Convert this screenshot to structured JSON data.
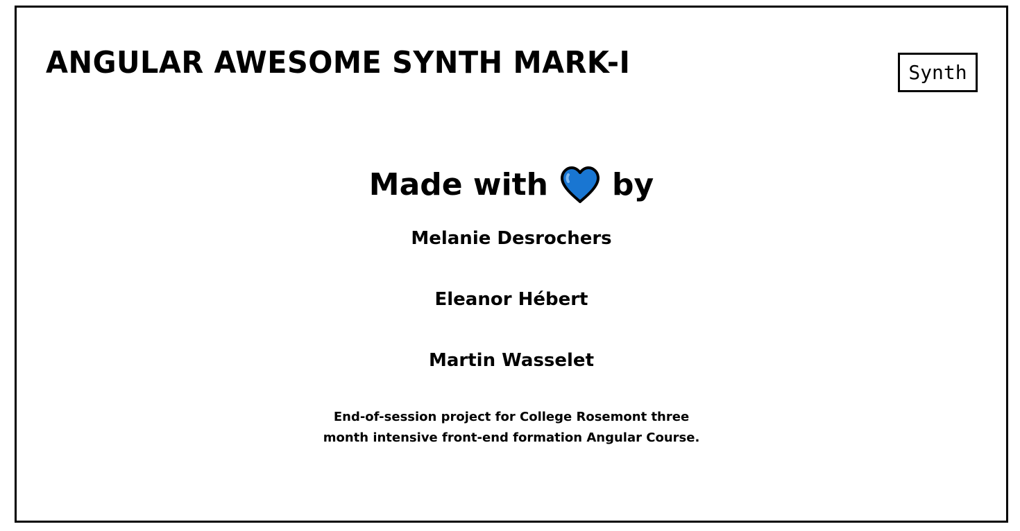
{
  "header": {
    "title": "ANGULAR AWESOME SYNTH MARK-I",
    "synth_button_label": "Synth"
  },
  "credits": {
    "made_with_prefix": "Made with",
    "heart_icon": "blue-heart-icon",
    "made_with_suffix": "by",
    "authors": [
      "Melanie Desrochers",
      "Eleanor Hébert",
      "Martin Wasselet"
    ],
    "description": "End-of-session project for College Rosemont three month intensive front-end formation Angular Course."
  },
  "colors": {
    "border": "#000000",
    "background": "#ffffff",
    "heart": "#1976d2"
  }
}
